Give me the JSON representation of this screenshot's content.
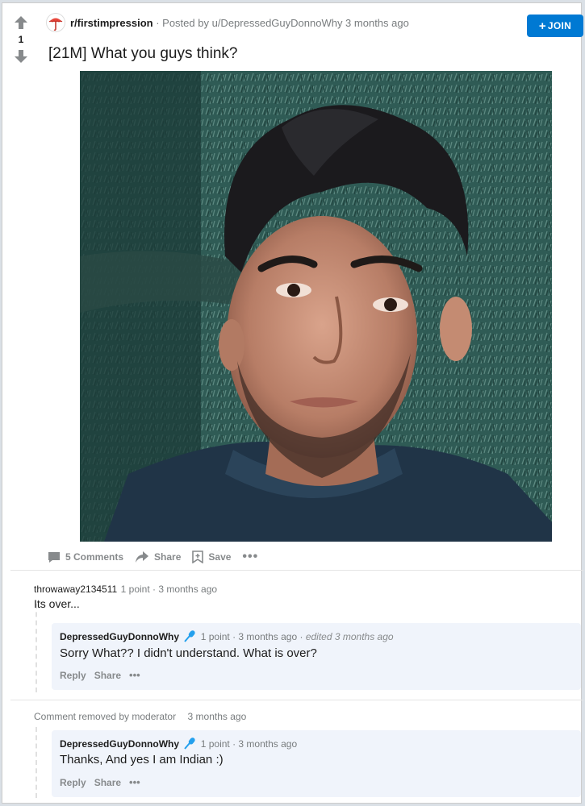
{
  "post": {
    "score": "1",
    "subreddit": "r/firstimpression",
    "posted_by": "· Posted by u/DepressedGuyDonnoWhy 3 months ago",
    "join_label": "JOIN",
    "title": "[21M] What you guys think?",
    "image_alt": "Photo of a young man with dark tousled hair against a green textured background",
    "actions": {
      "comments": "5 Comments",
      "share": "Share",
      "save": "Save"
    }
  },
  "comments": [
    {
      "author": "throwaway2134511",
      "meta": "1 point · 3 months ago",
      "body": "Its over...",
      "reply": {
        "author": "DepressedGuyDonnoWhy",
        "meta": "1 point · 3 months ago ·",
        "edited": "edited 3 months ago",
        "body": "Sorry What?? I didn't understand. What is over?",
        "reply_label": "Reply",
        "share_label": "Share"
      }
    },
    {
      "author": "Comment removed by moderator",
      "meta": "3 months ago",
      "reply": {
        "author": "DepressedGuyDonnoWhy",
        "meta": "1 point · 3 months ago",
        "body": "Thanks, And yes I am Indian :)",
        "reply_label": "Reply",
        "share_label": "Share"
      }
    }
  ],
  "icons": [
    "upvote-icon",
    "downvote-icon",
    "subreddit-icon",
    "comment-icon",
    "share-icon",
    "save-icon",
    "more-icon",
    "microphone-icon"
  ],
  "colors": {
    "accent": "#0079d3",
    "reply_bg": "#f0f4fb",
    "muted": "#787c7e"
  }
}
